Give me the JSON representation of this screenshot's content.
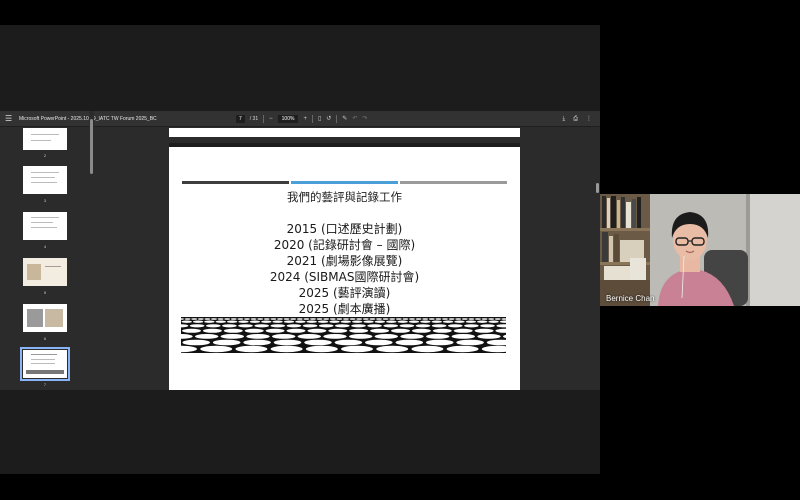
{
  "viewer": {
    "title": "Microsoft PowerPoint - 2025.10.29_IATC TW Forum 2025_BC",
    "page_current": "7",
    "page_total": "/ 31",
    "zoom": "100%",
    "icons": {
      "menu": "hamburger-icon",
      "zoom_out": "minus-icon",
      "zoom_in": "plus-icon",
      "fit": "fit-page-icon",
      "rotate": "rotate-icon",
      "annotate": "pen-icon",
      "undo": "undo-icon",
      "redo": "redo-icon",
      "download": "download-icon",
      "print": "print-icon",
      "more": "more-vert-icon"
    }
  },
  "sidebar": {
    "thumbnails": [
      {
        "num": "2"
      },
      {
        "num": "3"
      },
      {
        "num": "4"
      },
      {
        "num": "5"
      },
      {
        "num": "6"
      },
      {
        "num": "7",
        "selected": true
      }
    ]
  },
  "slide": {
    "title": "我們的藝評與記錄工作",
    "lines": [
      "2015 (口述歷史計劃)",
      "2020 (記錄研討會 – 國際)",
      "2021 (劇場影像展覽)",
      "2024 (SIBMAS國際研討會)",
      "2025 (藝評演讀)",
      "2025 (劇本廣播)"
    ],
    "rule_colors": [
      "#3d3d3d",
      "#4a9fd8",
      "#9a9a9a"
    ]
  },
  "participant": {
    "name": "Bernice Chan"
  }
}
